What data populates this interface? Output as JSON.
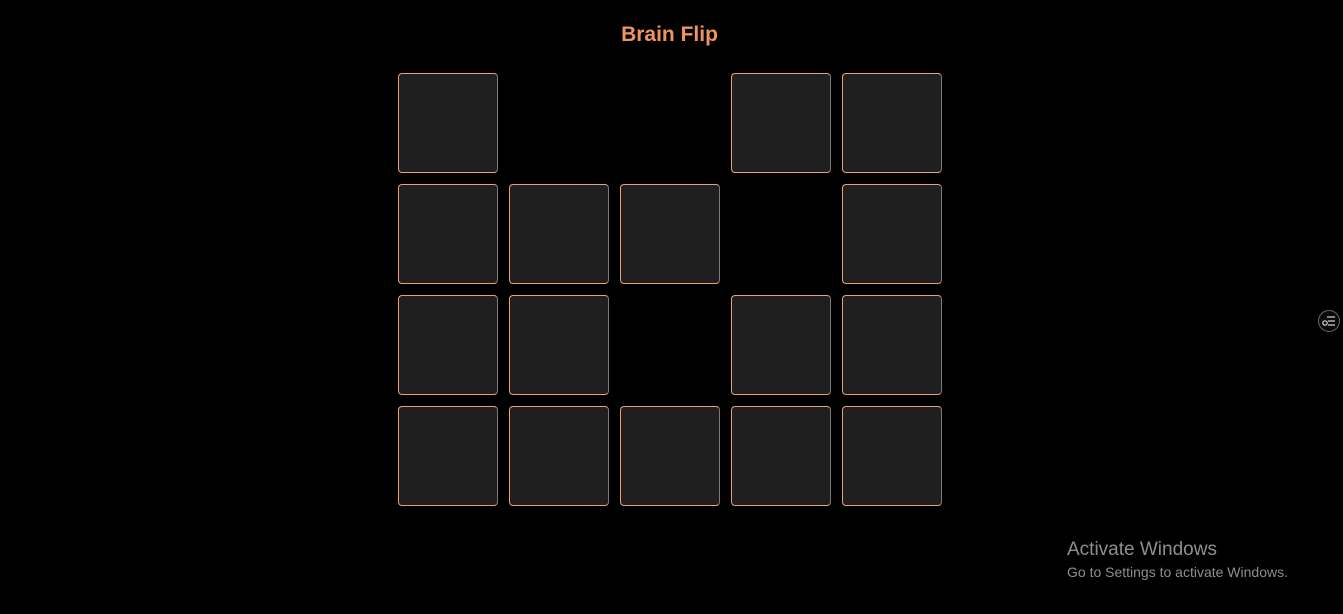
{
  "title": "Brain Flip",
  "colors": {
    "accent": "#f0955a",
    "card_face_down": "#1f1f1f",
    "background": "#000000"
  },
  "board": {
    "columns": 5,
    "rows": 4,
    "cards": [
      {
        "state": "face-down"
      },
      {
        "state": "matched"
      },
      {
        "state": "matched"
      },
      {
        "state": "face-down"
      },
      {
        "state": "face-down"
      },
      {
        "state": "face-down"
      },
      {
        "state": "face-down"
      },
      {
        "state": "face-down"
      },
      {
        "state": "matched"
      },
      {
        "state": "face-down"
      },
      {
        "state": "face-down"
      },
      {
        "state": "face-down"
      },
      {
        "state": "matched"
      },
      {
        "state": "face-down"
      },
      {
        "state": "face-down"
      },
      {
        "state": "face-down"
      },
      {
        "state": "face-down"
      },
      {
        "state": "face-down"
      },
      {
        "state": "face-down"
      },
      {
        "state": "face-down"
      }
    ]
  },
  "side_widget": {
    "icon": "options-icon"
  },
  "watermark": {
    "title": "Activate Windows",
    "subtitle": "Go to Settings to activate Windows."
  }
}
